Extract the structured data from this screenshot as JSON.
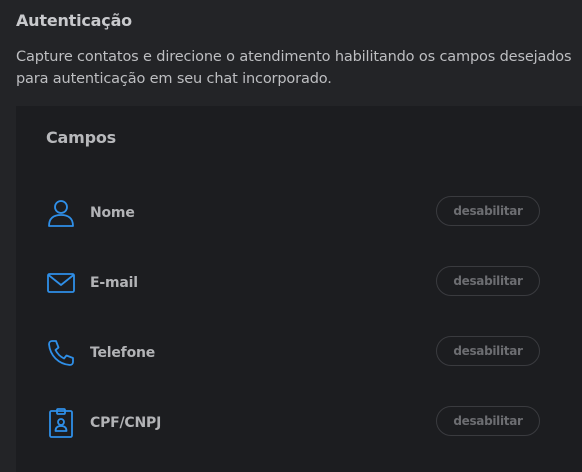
{
  "header": {
    "title": "Autenticação",
    "description": "Capture contatos e direcione o atendimento habilitando os campos desejados para autenticação em seu chat incorporado."
  },
  "fields_panel": {
    "title": "Campos",
    "accent_color": "#2f8fe8",
    "fields": [
      {
        "icon": "user-icon",
        "label": "Nome",
        "button_label": "desabilitar"
      },
      {
        "icon": "envelope-icon",
        "label": "E-mail",
        "button_label": "desabilitar"
      },
      {
        "icon": "phone-icon",
        "label": "Telefone",
        "button_label": "desabilitar"
      },
      {
        "icon": "id-badge-icon",
        "label": "CPF/CNPJ",
        "button_label": "desabilitar"
      }
    ]
  }
}
